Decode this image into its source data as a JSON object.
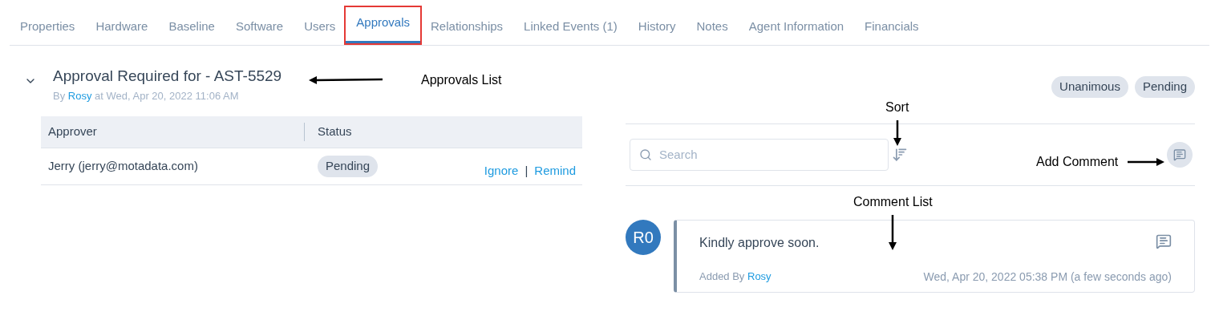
{
  "tabs": [
    {
      "label": "Properties",
      "selected": false,
      "highlighted": false
    },
    {
      "label": "Hardware",
      "selected": false,
      "highlighted": false
    },
    {
      "label": "Baseline",
      "selected": false,
      "highlighted": false
    },
    {
      "label": "Software",
      "selected": false,
      "highlighted": false
    },
    {
      "label": "Users",
      "selected": false,
      "highlighted": false
    },
    {
      "label": "Approvals",
      "selected": true,
      "highlighted": true
    },
    {
      "label": "Relationships",
      "selected": false,
      "highlighted": false
    },
    {
      "label": "Linked Events (1)",
      "selected": false,
      "highlighted": false
    },
    {
      "label": "History",
      "selected": false,
      "highlighted": false
    },
    {
      "label": "Notes",
      "selected": false,
      "highlighted": false
    },
    {
      "label": "Agent Information",
      "selected": false,
      "highlighted": false
    },
    {
      "label": "Financials",
      "selected": false,
      "highlighted": false
    }
  ],
  "approval": {
    "expanded": true,
    "title": "Approval Required for - AST-5529",
    "by_prefix": "By",
    "by_user": "Rosy",
    "at_text": "at Wed, Apr 20, 2022 11:06 AM",
    "tags": [
      "Unanimous",
      "Pending"
    ],
    "table": {
      "columns": [
        "Approver",
        "Status"
      ],
      "rows": [
        {
          "approver": "Jerry (jerry@motadata.com)",
          "status": "Pending",
          "actions": [
            "Ignore",
            "Remind"
          ],
          "separator": "|"
        }
      ]
    }
  },
  "comments": {
    "search": {
      "placeholder": "Search"
    },
    "items": [
      {
        "avatar": "R0",
        "text": "Kindly approve soon.",
        "added_prefix": "Added By",
        "added_user": "Rosy",
        "time": "Wed, Apr 20, 2022 05:38 PM (a few seconds ago)"
      }
    ]
  },
  "annotations": [
    {
      "label": "Approvals List",
      "kind": "left"
    },
    {
      "label": "Sort",
      "kind": "down"
    },
    {
      "label": "Add Comment",
      "kind": "right"
    },
    {
      "label": "Comment List",
      "kind": "down"
    }
  ]
}
